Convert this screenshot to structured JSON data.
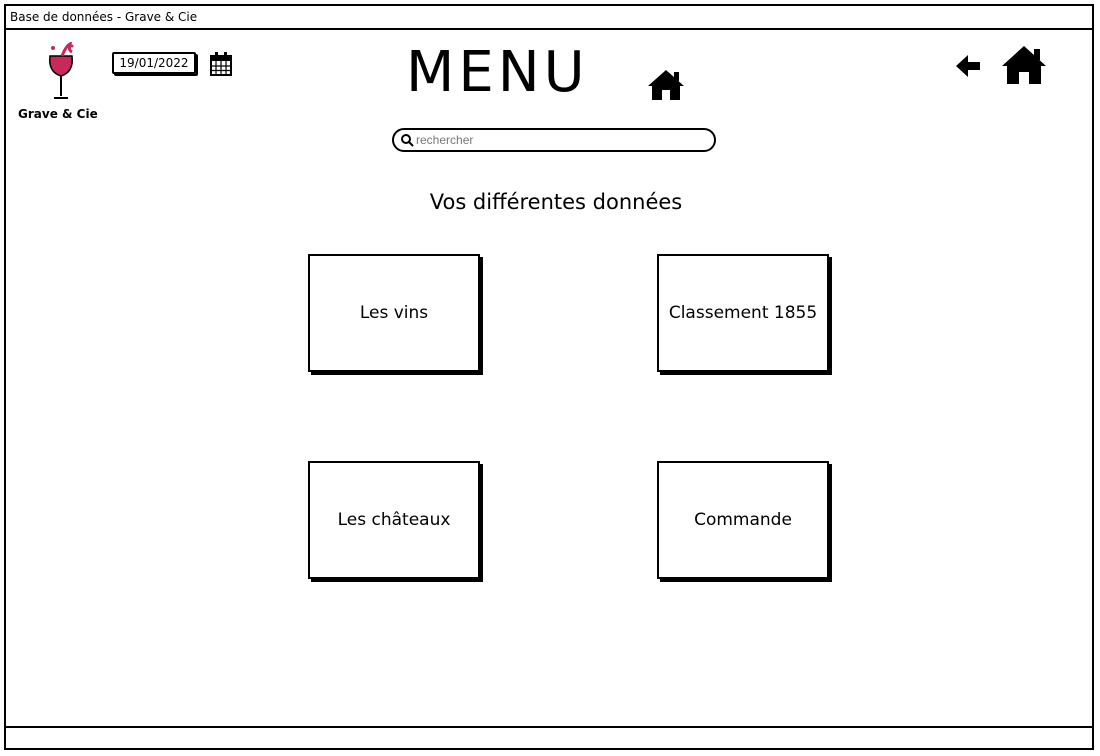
{
  "window": {
    "title": "Base de données - Grave & Cie"
  },
  "brand": {
    "name": "Grave & Cie",
    "logo_icon": "wine-glass-icon",
    "accent": "#c8285a"
  },
  "date": {
    "value": "19/01/2022",
    "icon": "calendar-icon"
  },
  "header": {
    "title": "MENU",
    "title_icon": "home-icon"
  },
  "nav": {
    "back_icon": "arrow-left-icon",
    "home_icon": "home-icon"
  },
  "search": {
    "placeholder": "rechercher",
    "value": "",
    "icon": "search-icon"
  },
  "main": {
    "subtitle": "Vos différentes données",
    "tiles": [
      {
        "label": "Les vins"
      },
      {
        "label": "Classement 1855"
      },
      {
        "label": "Les châteaux"
      },
      {
        "label": "Commande"
      }
    ]
  }
}
